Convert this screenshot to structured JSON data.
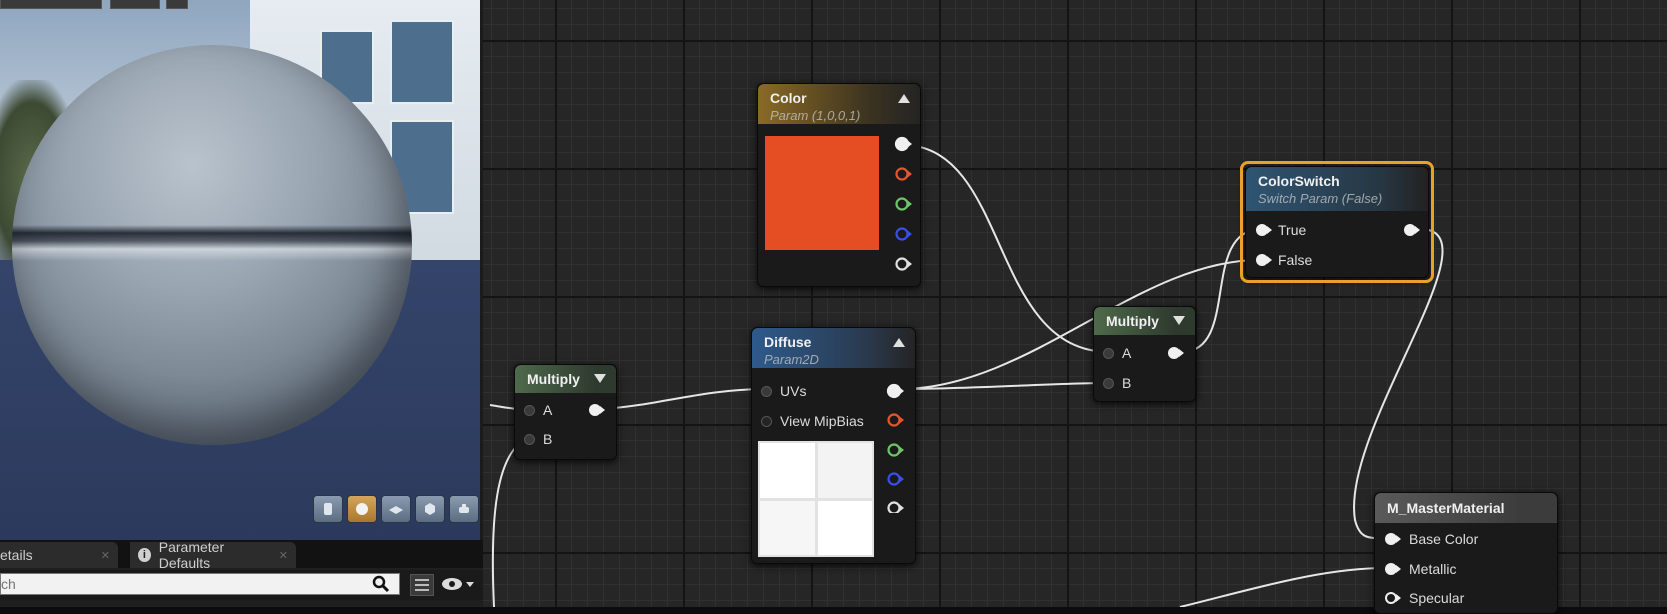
{
  "viewport": {
    "preview_buttons": [
      {
        "name": "cylinder-preview-icon",
        "active": false
      },
      {
        "name": "sphere-preview-icon",
        "active": true
      },
      {
        "name": "plane-preview-icon",
        "active": false
      },
      {
        "name": "cube-preview-icon",
        "active": false
      },
      {
        "name": "teapot-preview-icon",
        "active": false
      }
    ]
  },
  "bottom_panel": {
    "tabs": [
      {
        "label": "etails"
      },
      {
        "label": "Parameter Defaults"
      }
    ],
    "search_placeholder": "ch"
  },
  "nodes": {
    "color": {
      "title": "Color",
      "subtitle": "Param (1,0,0,1)",
      "swatch": "#e54d22",
      "header_color": "#8a6a25"
    },
    "diffuse": {
      "title": "Diffuse",
      "subtitle": "Param2D",
      "header_color": "#2d5a8c",
      "inputs": [
        "UVs",
        "View MipBias"
      ]
    },
    "multiply_left": {
      "title": "Multiply",
      "inputs": [
        "A",
        "B"
      ]
    },
    "multiply_right": {
      "title": "Multiply",
      "inputs": [
        "A",
        "B"
      ]
    },
    "colorswitch": {
      "title": "ColorSwitch",
      "subtitle": "Switch Param (False)",
      "inputs": [
        "True",
        "False"
      ],
      "selection_color": "#e8a22a"
    },
    "master": {
      "title": "M_MasterMaterial",
      "inputs": [
        "Base Color",
        "Metallic",
        "Specular"
      ]
    }
  },
  "colors": {
    "pin_red": "#e4552e",
    "pin_green": "#6fc46a",
    "pin_blue": "#3a4ee8",
    "pin_white": "#f0f0f0",
    "wire": "#e6e6e6"
  }
}
